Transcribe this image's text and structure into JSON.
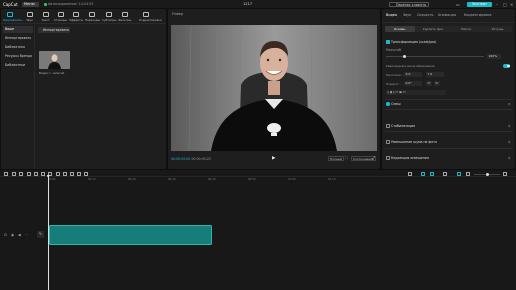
{
  "app": {
    "logo": "CapCut",
    "menu_label": "Меню",
    "autosave": "Автосохранение: 14:24:55",
    "window_title": "1217",
    "pro_button": "Перенос клиента",
    "export_button": "Экспорт",
    "accent": "#1db9c7"
  },
  "tools": [
    {
      "label": "Медиафайлы",
      "icon": "media-icon",
      "active": true
    },
    {
      "label": "Звук",
      "icon": "audio-icon"
    },
    {
      "label": "Текст",
      "icon": "text-icon"
    },
    {
      "label": "Стикеры",
      "icon": "sticker-icon"
    },
    {
      "label": "Эффекты",
      "icon": "effects-icon"
    },
    {
      "label": "Переходы",
      "icon": "transitions-icon"
    },
    {
      "label": "Субтитры",
      "icon": "captions-icon"
    },
    {
      "label": "Фильтры",
      "icon": "filters-icon"
    },
    {
      "label": "Корректировка",
      "icon": "adjust-icon"
    }
  ],
  "sidebar": {
    "items": [
      "Ваше",
      "Импортировать",
      "Библиотека",
      "Ресурсы бренда",
      "Библиотеки"
    ]
  },
  "media": {
    "import_label": "Импортировать",
    "clip_name": "Видео.т. записей"
  },
  "player": {
    "title": "Плеер",
    "time_current": "00:00:00:00",
    "time_total": "00:00:45:22",
    "btn_full": "Полный",
    "btn_ratio": "Соотношение"
  },
  "inspector": {
    "tabs": [
      "Видео",
      "Звук",
      "Скорость",
      "Анимация",
      "Корректировка"
    ],
    "subtabs": [
      "Основн.",
      "Удалить фон",
      "Маска",
      "Ретушь"
    ],
    "transform_title": "Трансформация (scale/pos)",
    "scale_label": "Масштаб",
    "scale_value": "100%",
    "uniform_label": "Равномерное масштабирование",
    "pos_label": "Располож...",
    "pos_x": "X  0",
    "pos_y": "Y  0",
    "rotate_label": "Поворот...",
    "rotate_value": "0.0°",
    "blend_label": "Смеш",
    "stabilize_label": "Стабилизация",
    "denoise_label": "Уменьшение шума на фото",
    "color_label": "Коррекция освещения"
  },
  "timeline": {
    "ticks": [
      "00:00",
      "00:10",
      "00:20",
      "00:30",
      "00:40",
      "00:50",
      "01:00",
      "01:10"
    ]
  }
}
